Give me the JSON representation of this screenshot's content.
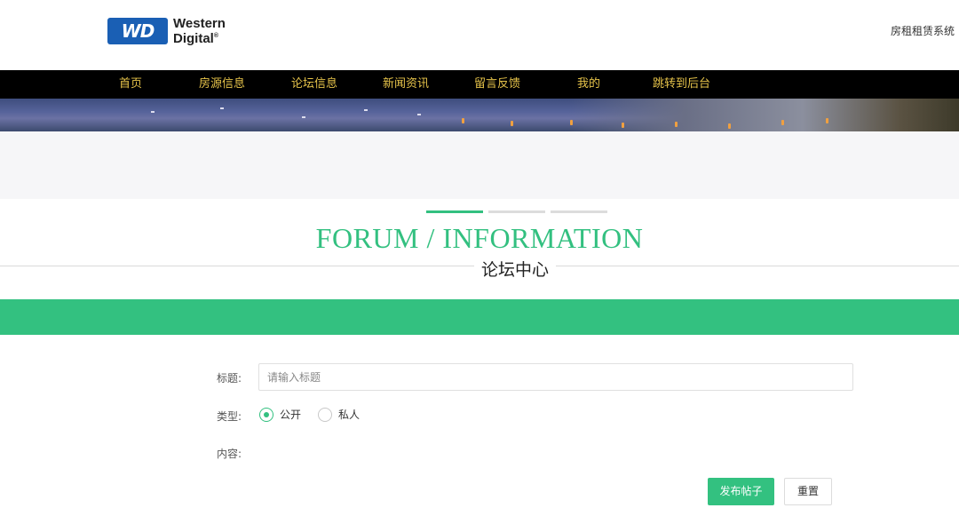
{
  "header": {
    "logo_badge": "WD",
    "logo_line1": "Western",
    "logo_line2": "Digital",
    "logo_reg": "®",
    "system_name": "房租租赁系统"
  },
  "nav": {
    "items": [
      {
        "label": "首页"
      },
      {
        "label": "房源信息"
      },
      {
        "label": "论坛信息"
      },
      {
        "label": "新闻资讯"
      },
      {
        "label": "留言反馈"
      },
      {
        "label": "我的"
      },
      {
        "label": "跳转到后台"
      }
    ]
  },
  "section": {
    "title_en": "FORUM / INFORMATION",
    "title_cn": "论坛中心"
  },
  "form": {
    "title_label": "标题:",
    "title_placeholder": "请输入标题",
    "title_value": "",
    "type_label": "类型:",
    "type_options": [
      {
        "label": "公开",
        "checked": true
      },
      {
        "label": "私人",
        "checked": false
      }
    ],
    "content_label": "内容:",
    "submit_label": "发布帖子",
    "reset_label": "重置"
  },
  "colors": {
    "accent": "#33c080",
    "nav_bg": "#000000",
    "nav_text": "#e6c34a",
    "logo_blue": "#1a5fb4"
  }
}
